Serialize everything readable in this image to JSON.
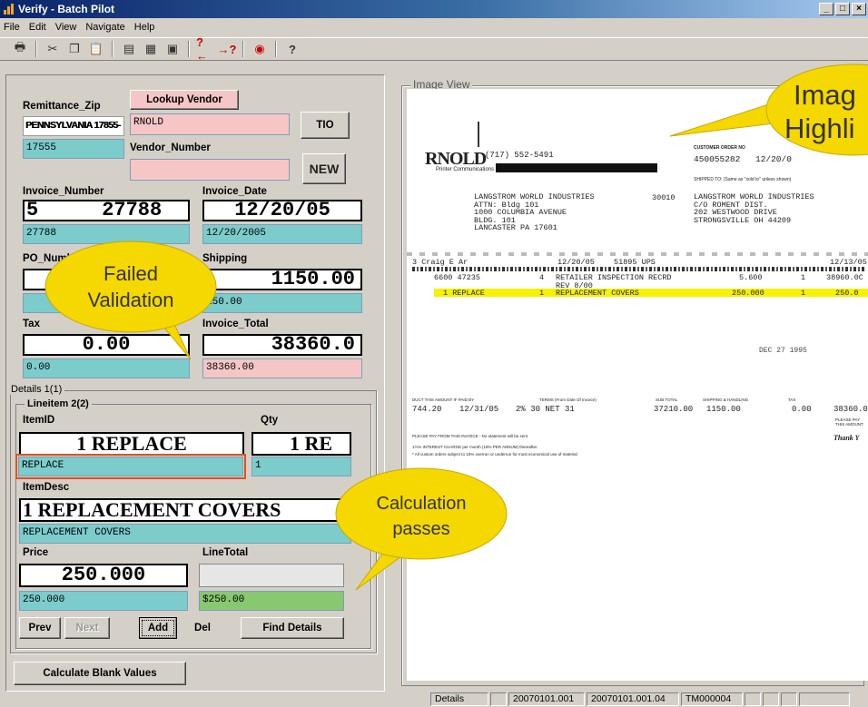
{
  "window": {
    "title": "Verify - Batch Pilot",
    "controls": [
      "_",
      "□",
      "×"
    ]
  },
  "menu": [
    "File",
    "Edit",
    "View",
    "Navigate",
    "Help"
  ],
  "toolbar": [
    "printer-icon",
    "cut-icon",
    "copy-icon",
    "paste-icon",
    "fields-icon",
    "grid-icon",
    "frame-icon",
    "prev-question-icon",
    "next-question-icon",
    "lifebuoy-icon",
    "help-icon"
  ],
  "form": {
    "remittance_zip": {
      "label": "Remittance_Zip",
      "image_text": "PENNSYLVANIA 17855-",
      "value": "17555"
    },
    "lookup_vendor": "Lookup Vendor",
    "vendor_name": "RNOLD",
    "tio": "TIO",
    "new": "NEW",
    "vendor_number": {
      "label": "Vendor_Number",
      "value": ""
    },
    "invoice_number": {
      "label": "Invoice_Number",
      "image_prefix": "5",
      "image_text": "27788",
      "value": "27788"
    },
    "invoice_date": {
      "label": "Invoice_Date",
      "image_text": "12/20/05",
      "value": "12/20/2005"
    },
    "po_number": {
      "label": "PO_Numb",
      "value": ""
    },
    "shipping": {
      "label": "Shipping",
      "image_text": "1150.00",
      "value": "150.00"
    },
    "tax": {
      "label": "Tax",
      "image_text": "0.00",
      "value": "0.00"
    },
    "invoice_total": {
      "label": "Invoice_Total",
      "image_text": "38360.0",
      "value": "38360.00"
    },
    "details_group": "Details 1(1)",
    "lineitem_group": "Lineitem 2(2)",
    "item_id": {
      "label": "ItemID",
      "image_text": "1  REPLACE",
      "value": "REPLACE"
    },
    "qty": {
      "label": "Qty",
      "image_text": "1  RE",
      "value": "1"
    },
    "item_desc": {
      "label": "ItemDesc",
      "image_text": "1  REPLACEMENT COVERS",
      "value": "REPLACEMENT COVERS"
    },
    "price": {
      "label": "Price",
      "image_text": "250.000",
      "value": "250.000"
    },
    "line_total": {
      "label": "LineTotal",
      "image_text": "",
      "value": "$250.00"
    },
    "buttons": {
      "prev": "Prev",
      "next": "Next",
      "add": "Add",
      "del": "Del",
      "find_details": "Find Details",
      "calculate": "Calculate Blank Values"
    }
  },
  "image_view": {
    "label": "Image View",
    "logo": "RNOLD",
    "logo_sub": "Printer Communications",
    "phone": "(717) 552-5491",
    "customer_order_label": "CUSTOMER ORDER NO",
    "customer_order": "450055282",
    "date_top": "12/20/0",
    "ship_to_label": "SHIPPED TO: (Same as \"sold to\" unless shown)",
    "bill_to": [
      "LANGSTROM WORLD INDUSTRIES",
      "ATTN: Bldg 101",
      "1000 COLUMBIA AVENUE",
      "BLDG. 101",
      "LANCASTER PA  17601"
    ],
    "bill_code": "30010",
    "ship_to": [
      "LANGSTROM WORLD INDUSTRIES",
      "C/O ROMENT DIST.",
      "202 WESTWOOD DRIVE",
      "STRONGSVILLE OH  44209"
    ],
    "order_line": "3 Craig E Ar",
    "order_date": "12/20/05",
    "order_ship": "51895 UPS",
    "order_date_right": "12/13/05",
    "line1": {
      "code": "6600 47235",
      "qty": "4",
      "desc": "RETAILER INSPECTION RECRD",
      "price": "5.600",
      "q2": "1",
      "total": "38960.0C"
    },
    "line1_rev": "REV 8/00",
    "line2": {
      "code": "1 REPLACE",
      "qty": "1",
      "desc": "REPLACEMENT COVERS",
      "price": "250.000",
      "q2": "1",
      "total": "250.0"
    },
    "stamp": "DEC 27 1995",
    "totals_labels": [
      "DUCT THIS AMOUNT IF PAID BY",
      "TERMS (From Date Of Invoice)",
      "SUB TOTAL",
      "SHIPPING & HANDLING",
      "TAX"
    ],
    "totals": {
      "discount": "744.20",
      "date": "12/31/05",
      "terms": "2% 30 NET 31",
      "subtotal": "37210.00",
      "shipping": "1150.00",
      "tax": "0.00",
      "total": "38360.0"
    },
    "please_pay": "PLEASE PAY THIS AMOUNT",
    "thank_you": "Thank Y",
    "footer": [
      "PLEASE PAY FROM THIS INVOICE - No statement will be sent",
      "1½% INTEREST CHARGE per month (18% PER ANNUM) thereafter",
      "* All custom orders subject to 10% overrun or underrun for most economical use of material"
    ]
  },
  "callouts": {
    "failed": [
      "Failed",
      "Validation"
    ],
    "calc": [
      "Calculation",
      "passes"
    ],
    "image": [
      "Imag",
      "Highli"
    ]
  },
  "status": [
    "Details",
    "20070101.001",
    "20070101.001.04",
    "TM000004"
  ],
  "colors": {
    "teal": "#7ccccc",
    "pink": "#f6c6c6",
    "green": "#88c870",
    "callout": "#f5d800",
    "highlight": "#f6f200"
  }
}
